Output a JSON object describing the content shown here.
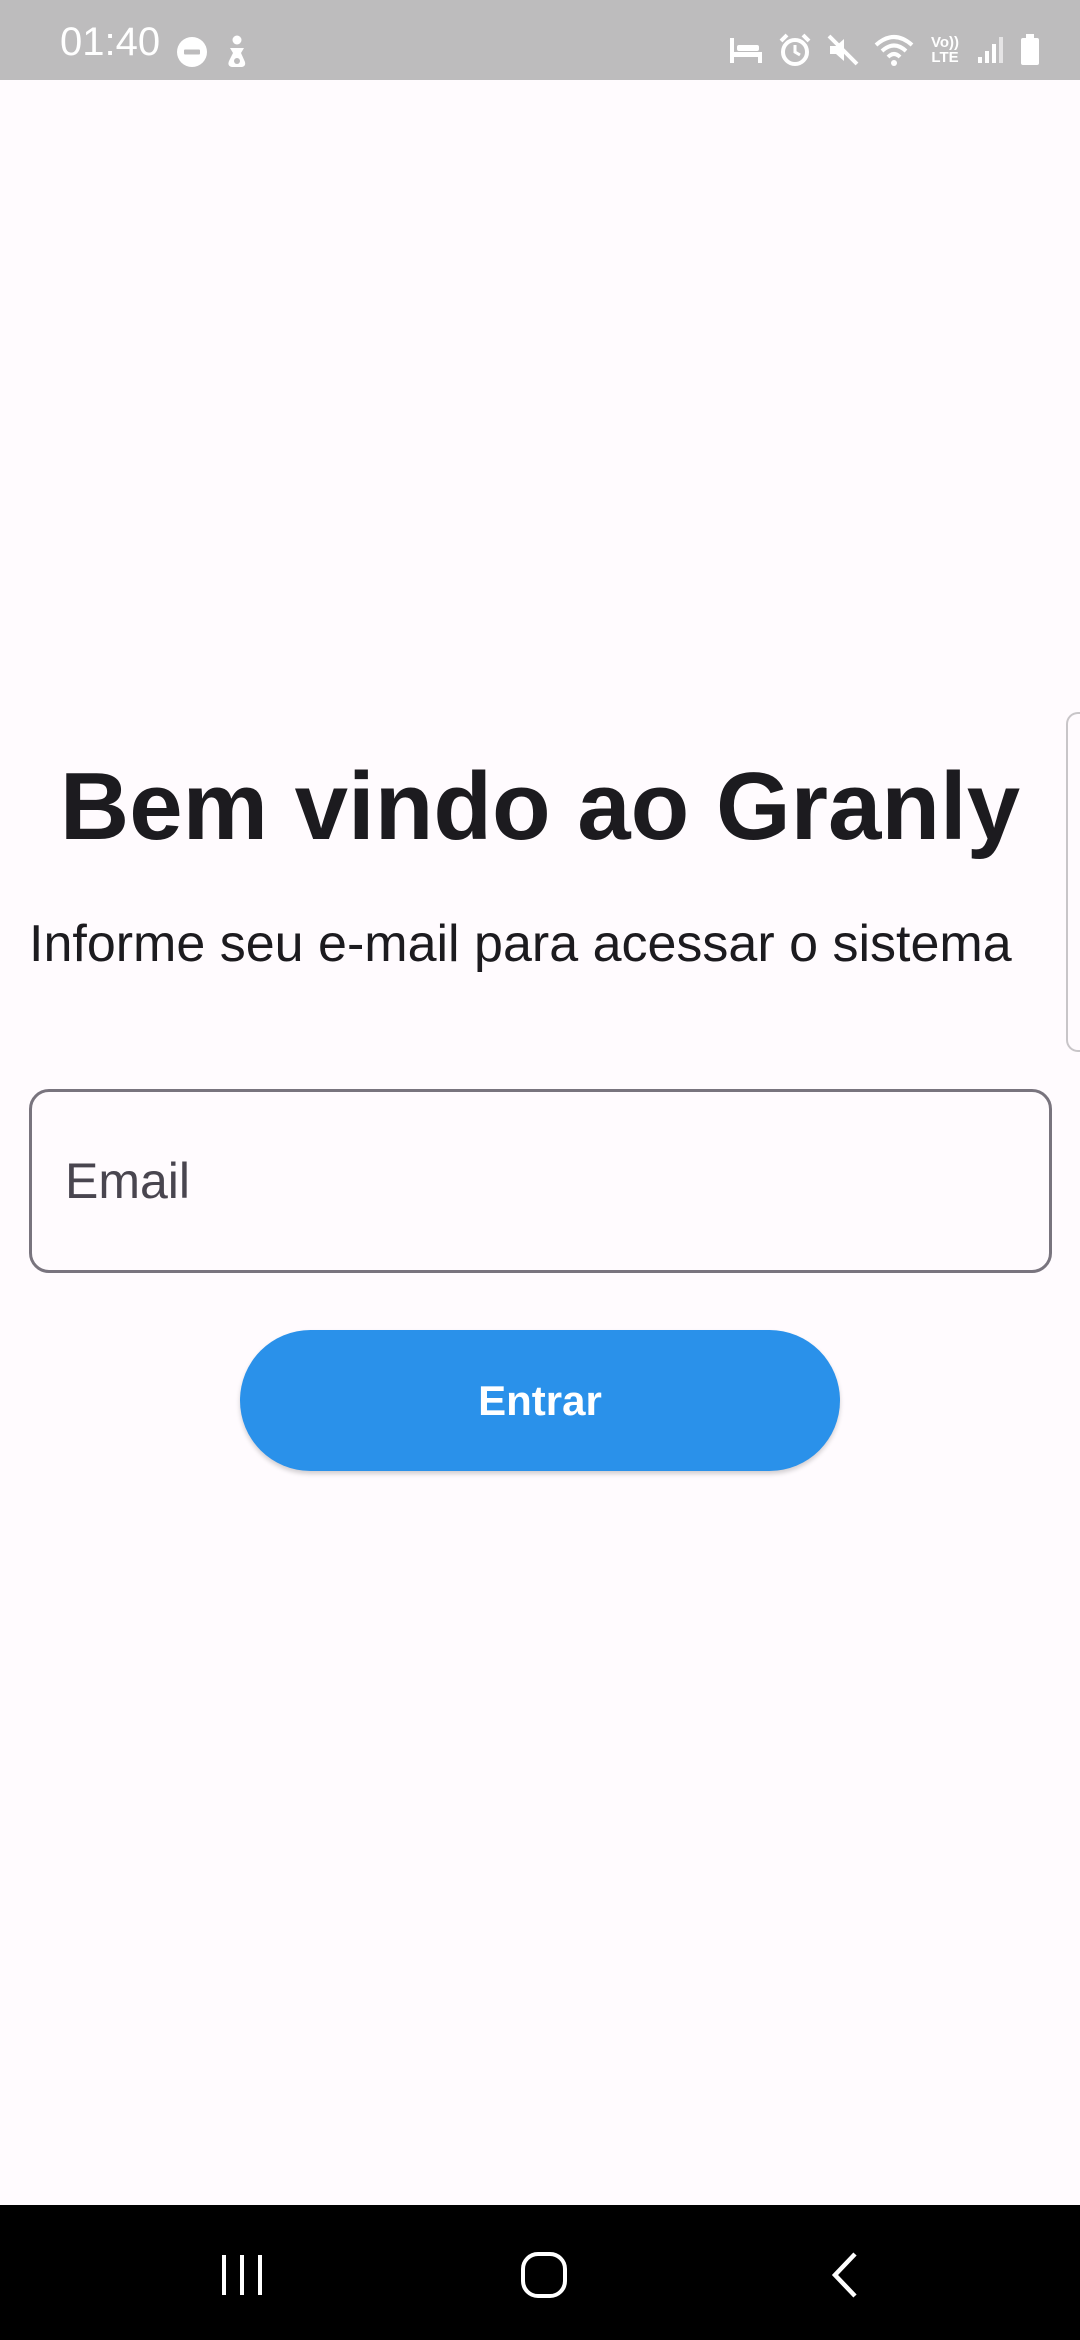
{
  "status_bar": {
    "time": "01:40",
    "left_icons": [
      "do-not-disturb-icon",
      "accessibility-icon"
    ],
    "right_icons": [
      "bedtime-icon",
      "alarm-icon",
      "mute-icon",
      "wifi-icon",
      "volte-icon",
      "signal-icon",
      "battery-icon"
    ],
    "volte_label_top": "Vo))",
    "volte_label_bottom": "LTE"
  },
  "login": {
    "title": "Bem vindo ao Granly",
    "subtitle": "Informe seu e-mail para acessar o sistema",
    "email_placeholder": "Email",
    "email_value": "",
    "submit_label": "Entrar"
  },
  "colors": {
    "background": "#fffbfe",
    "status_bar": "#bdbcbd",
    "primary_button": "#2a91ea",
    "text": "#1c1b1f",
    "field_border": "#79747e",
    "nav_bar": "#000000"
  },
  "nav_bar": {
    "buttons": [
      "recents-icon",
      "home-icon",
      "back-icon"
    ]
  }
}
